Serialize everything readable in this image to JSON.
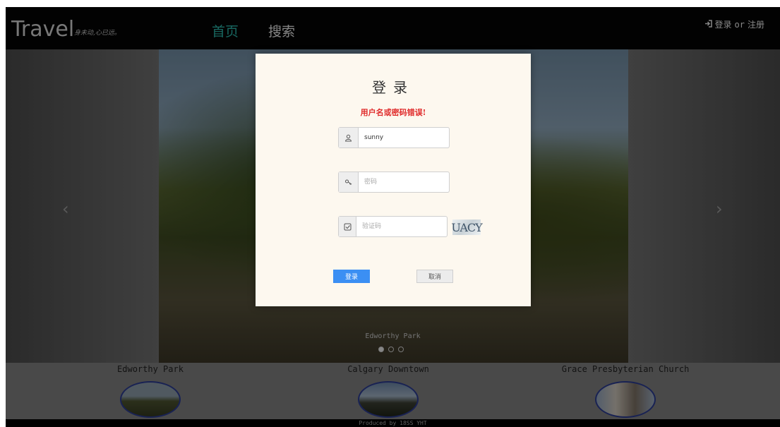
{
  "navbar": {
    "brand": "Travel",
    "slogan": "身未动,心已远。",
    "links": [
      {
        "label": "首页"
      },
      {
        "label": "搜索"
      }
    ],
    "login_icon": "login-icon",
    "login_label": "登录",
    "or_label": "or",
    "register_label": "注册"
  },
  "carousel": {
    "caption": "Edworthy Park",
    "slide_count": 3,
    "active_index": 0,
    "prev_arrow": "‹",
    "next_arrow": "›"
  },
  "dialog": {
    "title": "登录",
    "error": "用户名或密码错误!",
    "username": {
      "value": "sunny",
      "icon": "user-icon"
    },
    "password": {
      "placeholder": "密码",
      "icon": "key-icon"
    },
    "captcha": {
      "placeholder": "验证码",
      "icon": "check-square-icon",
      "image_text": "UACY"
    },
    "login_button": "登录",
    "cancel_button": "取消"
  },
  "cards": [
    {
      "title": "Edworthy Park"
    },
    {
      "title": "Calgary Downtown"
    },
    {
      "title": "Grace Presbyterian Church"
    }
  ],
  "footer": {
    "text": "Produced by 18SS YHT"
  },
  "colors": {
    "nav_active": "#2ab3a8",
    "error": "#e02b2b",
    "primary_button": "#3b8ff3",
    "thumb_border": "#2b3b8f"
  }
}
